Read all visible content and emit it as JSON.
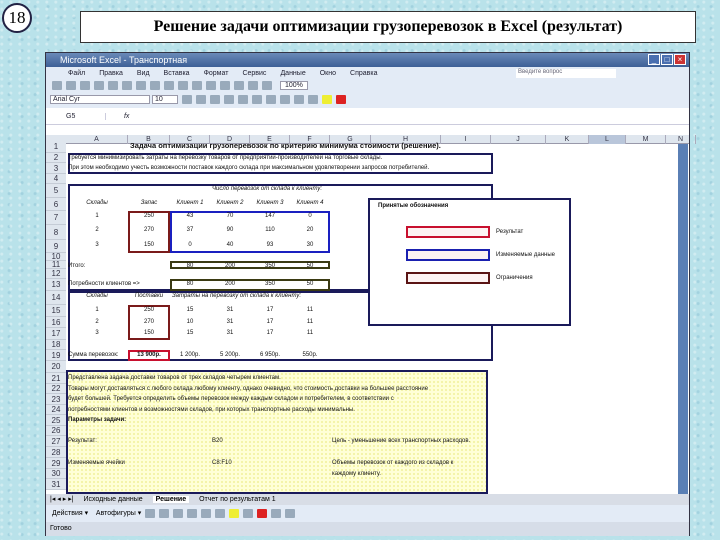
{
  "slide": {
    "number": "18",
    "title": "Решение задачи оптимизации грузоперевозок в Excel (результат)"
  },
  "excel": {
    "window_title": "Microsoft Excel - Транспортная",
    "menu": [
      "Файл",
      "Правка",
      "Вид",
      "Вставка",
      "Формат",
      "Сервис",
      "Данные",
      "Окно",
      "Справка"
    ],
    "help_placeholder": "Введите вопрос",
    "zoom": "100%",
    "font_name": "Arial Cyr",
    "font_size": "10",
    "name_box": "G5",
    "fx": "fx",
    "columns": [
      "A",
      "B",
      "C",
      "D",
      "E",
      "F",
      "G",
      "H",
      "I",
      "J",
      "K",
      "L",
      "M",
      "N"
    ],
    "rows": [
      "1",
      "2",
      "3",
      "4",
      "5",
      "6",
      "7",
      "8",
      "9",
      "10",
      "11",
      "12",
      "13",
      "14",
      "15",
      "16",
      "17",
      "18",
      "19",
      "20",
      "21",
      "22",
      "23",
      "24",
      "25",
      "26",
      "27",
      "28",
      "29",
      "30",
      "31"
    ],
    "cells": [
      {
        "r": 1,
        "c": 1,
        "t": "Задача оптимизации грузоперевозок по критерию минимума стоимости (решение).",
        "b": true
      },
      {
        "r": 2,
        "c": 0,
        "t": "Требуется минимизировать затраты на перевозку товаров от предприятий-производителей на торговые склады."
      },
      {
        "r": 3,
        "c": 0,
        "t": "При этом необходимо учесть возможности поставок каждого склада при максимальном удовлетворении запросов потребителей."
      },
      {
        "r": 5,
        "c": 3,
        "t": "Число перевозок от склада к клиенту:",
        "i": true
      },
      {
        "r": 6,
        "c": 0,
        "t": "Склады",
        "i": true,
        "cc": true
      },
      {
        "r": 6,
        "c": 1,
        "t": "Запас",
        "i": true,
        "cc": true
      },
      {
        "r": 6,
        "c": 2,
        "t": "Клиент 1",
        "i": true,
        "cc": true
      },
      {
        "r": 6,
        "c": 3,
        "t": "Клиент 2",
        "i": true,
        "cc": true
      },
      {
        "r": 6,
        "c": 4,
        "t": "Клиент 3",
        "i": true,
        "cc": true
      },
      {
        "r": 6,
        "c": 5,
        "t": "Клиент 4",
        "i": true,
        "cc": true
      },
      {
        "r": 7,
        "c": 0,
        "t": "1",
        "cc": true
      },
      {
        "r": 7,
        "c": 1,
        "t": "250",
        "cc": true
      },
      {
        "r": 7,
        "c": 2,
        "t": "43",
        "cc": true
      },
      {
        "r": 7,
        "c": 3,
        "t": "70",
        "cc": true
      },
      {
        "r": 7,
        "c": 4,
        "t": "147",
        "cc": true
      },
      {
        "r": 7,
        "c": 5,
        "t": "0",
        "cc": true
      },
      {
        "r": 8,
        "c": 0,
        "t": "2",
        "cc": true
      },
      {
        "r": 8,
        "c": 1,
        "t": "270",
        "cc": true
      },
      {
        "r": 8,
        "c": 2,
        "t": "37",
        "cc": true
      },
      {
        "r": 8,
        "c": 3,
        "t": "90",
        "cc": true
      },
      {
        "r": 8,
        "c": 4,
        "t": "110",
        "cc": true
      },
      {
        "r": 8,
        "c": 5,
        "t": "20",
        "cc": true
      },
      {
        "r": 9,
        "c": 0,
        "t": "3",
        "cc": true
      },
      {
        "r": 9,
        "c": 1,
        "t": "150",
        "cc": true
      },
      {
        "r": 9,
        "c": 2,
        "t": "0",
        "cc": true
      },
      {
        "r": 9,
        "c": 3,
        "t": "40",
        "cc": true
      },
      {
        "r": 9,
        "c": 4,
        "t": "93",
        "cc": true
      },
      {
        "r": 9,
        "c": 5,
        "t": "30",
        "cc": true
      },
      {
        "r": 11,
        "c": 0,
        "t": "Итого:"
      },
      {
        "r": 11,
        "c": 2,
        "t": "80",
        "cc": true
      },
      {
        "r": 11,
        "c": 3,
        "t": "200",
        "cc": true
      },
      {
        "r": 11,
        "c": 4,
        "t": "350",
        "cc": true
      },
      {
        "r": 11,
        "c": 5,
        "t": "50",
        "cc": true
      },
      {
        "r": 13,
        "c": 0,
        "t": "Потребности клиентов =>"
      },
      {
        "r": 13,
        "c": 2,
        "t": "80",
        "cc": true
      },
      {
        "r": 13,
        "c": 3,
        "t": "200",
        "cc": true
      },
      {
        "r": 13,
        "c": 4,
        "t": "350",
        "cc": true
      },
      {
        "r": 13,
        "c": 5,
        "t": "50",
        "cc": true
      },
      {
        "r": 14,
        "c": 0,
        "t": "Склады",
        "i": true,
        "cc": true
      },
      {
        "r": 14,
        "c": 1,
        "t": "Поставки",
        "i": true,
        "cc": true
      },
      {
        "r": 14,
        "c": 2,
        "t": "Затраты на перевозку от склада к клиенту:",
        "i": true
      },
      {
        "r": 15,
        "c": 0,
        "t": "1",
        "cc": true
      },
      {
        "r": 15,
        "c": 1,
        "t": "250",
        "cc": true
      },
      {
        "r": 15,
        "c": 2,
        "t": "15",
        "cc": true
      },
      {
        "r": 15,
        "c": 3,
        "t": "31",
        "cc": true
      },
      {
        "r": 15,
        "c": 4,
        "t": "17",
        "cc": true
      },
      {
        "r": 15,
        "c": 5,
        "t": "11",
        "cc": true
      },
      {
        "r": 16,
        "c": 0,
        "t": "2",
        "cc": true
      },
      {
        "r": 16,
        "c": 1,
        "t": "270",
        "cc": true
      },
      {
        "r": 16,
        "c": 2,
        "t": "10",
        "cc": true
      },
      {
        "r": 16,
        "c": 3,
        "t": "31",
        "cc": true
      },
      {
        "r": 16,
        "c": 4,
        "t": "17",
        "cc": true
      },
      {
        "r": 16,
        "c": 5,
        "t": "11",
        "cc": true
      },
      {
        "r": 17,
        "c": 0,
        "t": "3",
        "cc": true
      },
      {
        "r": 17,
        "c": 1,
        "t": "150",
        "cc": true
      },
      {
        "r": 17,
        "c": 2,
        "t": "15",
        "cc": true
      },
      {
        "r": 17,
        "c": 3,
        "t": "31",
        "cc": true
      },
      {
        "r": 17,
        "c": 4,
        "t": "17",
        "cc": true
      },
      {
        "r": 17,
        "c": 5,
        "t": "11",
        "cc": true
      },
      {
        "r": 19,
        "c": 0,
        "t": "Сумма перевозок:"
      },
      {
        "r": 19,
        "c": 1,
        "t": "13 900р.",
        "b": true,
        "cc": true
      },
      {
        "r": 19,
        "c": 2,
        "t": "1 200р.",
        "cc": true
      },
      {
        "r": 19,
        "c": 3,
        "t": "5 200р.",
        "cc": true
      },
      {
        "r": 19,
        "c": 4,
        "t": "6 950р.",
        "cc": true
      },
      {
        "r": 19,
        "c": 5,
        "t": "550р.",
        "cc": true
      },
      {
        "r": 21,
        "c": 0,
        "t": "Представлена задача доставки товаров от трех складов четырем клиентам."
      },
      {
        "r": 22,
        "c": 0,
        "t": "Товары могут доставляться с любого склада любому клиенту, однако очевидно, что стоимость доставки на большее расстояние"
      },
      {
        "r": 23,
        "c": 0,
        "t": "будет большей. Требуется определить объемы перевозок между каждым складом и потребителем, в соответствии с"
      },
      {
        "r": 24,
        "c": 0,
        "t": "потребностями клиентов и возможностями складов, при которых транспортные расходы минимальны."
      },
      {
        "r": 25,
        "c": 0,
        "t": "Параметры задачи:",
        "b": true
      },
      {
        "r": 27,
        "c": 0,
        "t": "Результат:"
      },
      {
        "r": 27,
        "c": 3,
        "t": "B20"
      },
      {
        "r": 27,
        "c": 6,
        "t": "Цель - уменьшение всех транспортных расходов."
      },
      {
        "r": 29,
        "c": 0,
        "t": "Изменяемые ячейки"
      },
      {
        "r": 29,
        "c": 3,
        "t": "C8:F10"
      },
      {
        "r": 29,
        "c": 6,
        "t": "Объемы перевозок от каждого из складов к"
      },
      {
        "r": 30,
        "c": 6,
        "t": "каждому клиенту."
      }
    ],
    "legend": {
      "title": "Принятые обозначения",
      "items": [
        {
          "label": "Результат",
          "color": "#c8102e"
        },
        {
          "label": "Изменяемые данные",
          "color": "#1a20b0"
        },
        {
          "label": "Ограничения",
          "color": "#5a1414"
        }
      ]
    },
    "sheet_tabs": [
      "Исходные данные",
      "Решение",
      "Отчет по результатам 1"
    ],
    "active_tab": "Решение",
    "draw_toolbar": {
      "actions": "Действия",
      "autoshapes": "Автофигуры"
    },
    "status": "Готово"
  }
}
